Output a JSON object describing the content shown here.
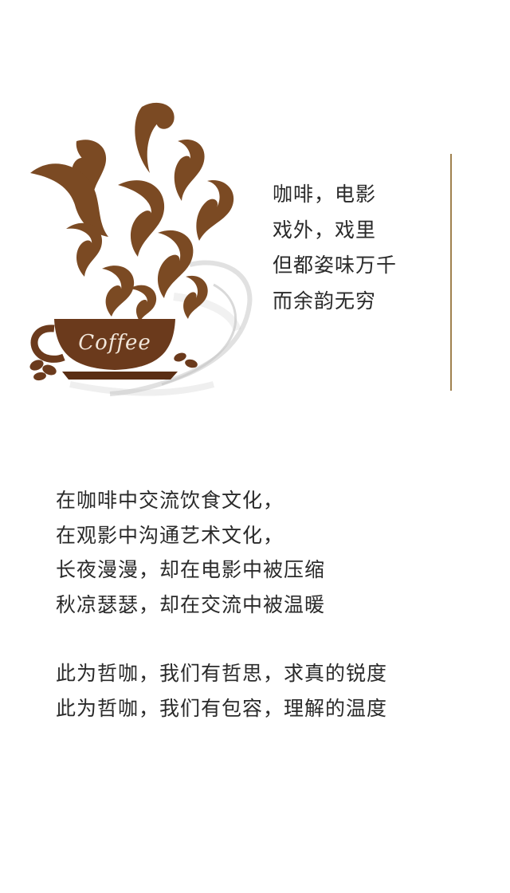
{
  "illustration": {
    "name": "coffee-cup-illustration",
    "cup_text": "Coffee",
    "colors": {
      "steam": "#7b4a23",
      "cup": "#6b3a1c",
      "saucer": "#5a2e14",
      "splash": "#cfcfcf"
    }
  },
  "poem": {
    "lines": [
      "咖啡，电影",
      "戏外，戏里",
      "但都姿味万千",
      "而余韵无穷"
    ]
  },
  "body": {
    "paragraphs": [
      {
        "lines": [
          "在咖啡中交流饮食文化，",
          "在观影中沟通艺术文化，",
          "长夜漫漫，却在电影中被压缩",
          "秋凉瑟瑟，却在交流中被温暖"
        ]
      },
      {
        "lines": [
          "此为哲咖，我们有哲思，求真的锐度",
          "此为哲咖，我们有包容，理解的温度"
        ]
      }
    ]
  },
  "accent_color": "#a0814f"
}
